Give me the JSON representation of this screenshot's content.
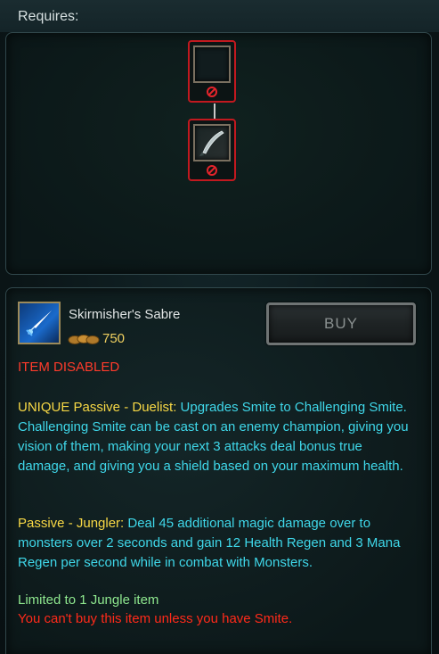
{
  "requires": {
    "title": "Requires:",
    "slots": [
      {
        "icon": "empty-slot-icon",
        "status": "disabled"
      },
      {
        "icon": "sabre-icon",
        "status": "disabled"
      }
    ]
  },
  "item": {
    "name": "Skirmisher's Sabre",
    "icon": "blue-sword-icon",
    "cost": "750",
    "buy_label": "BUY",
    "disabled_label": "ITEM DISABLED",
    "passives": [
      {
        "title": "UNIQUE Passive - Duelist:",
        "text": " Upgrades Smite to Challenging Smite. Challenging Smite can be cast on an enemy champion, giving you vision of them, making your next 3 attacks deal bonus true damage, and giving you a shield based on your maximum health."
      },
      {
        "title": "Passive - Jungler:",
        "text": "  Deal 45 additional magic damage over to monsters over 2 seconds and gain 12 Health Regen and 3 Mana Regen per second while in combat with Monsters."
      }
    ],
    "limited": "Limited to 1 Jungle item",
    "warning": "You can't buy this item unless you have Smite."
  },
  "colors": {
    "accent_gold": "#f7d845",
    "text_cyan": "#3fd7e9",
    "disabled_red": "#ff3b2b",
    "limited_green": "#8fe88f",
    "slot_border_red": "#c2191f"
  }
}
